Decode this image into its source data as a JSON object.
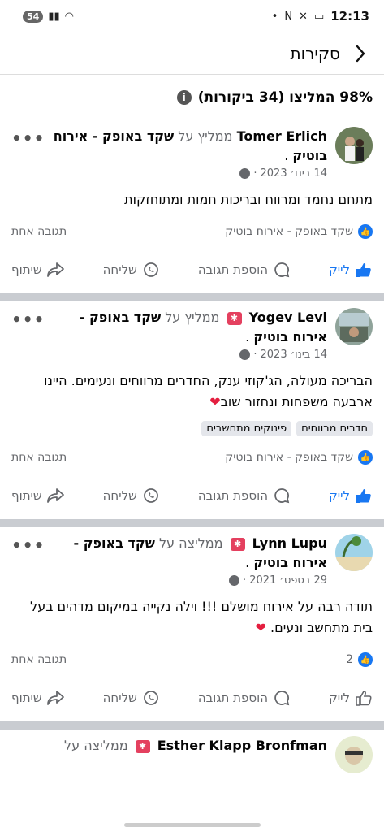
{
  "status_bar": {
    "notification_count": "54",
    "time": "12:13"
  },
  "header": {
    "title": "סקירות"
  },
  "summary": {
    "text": "98% המליצו (34 ביקורות)"
  },
  "colors": {
    "accent": "#1877f2",
    "badge": "#e4405f",
    "heart": "#e41e3f",
    "divider": "#c9ccd1"
  },
  "reviews": [
    {
      "name": "Tomer Erlich",
      "verb": "ממליץ על",
      "page": "שקד באופק - אירוח בוטיק",
      "date": "14 בינו׳ 2023",
      "body": "מתחם נחמד ומרווח ובריכות חמות ומתוחזקות",
      "tags": [],
      "reaction_label": "שקד באופק - אירוח בוטיק",
      "reply_count": "תגובה אחת",
      "liked": true,
      "has_badge": false
    },
    {
      "name": "Yogev Levi",
      "verb": "ממליץ על",
      "page": "שקד באופק - אירוח בוטיק",
      "date": "14 בינו׳ 2023",
      "body": "הבריכה מעולה, הג'קוזי ענק, החדרים מרווחים ונעימים. היינו ארבעה משפחות ונחזור שוב",
      "tags": [
        "חדרים מרווחים",
        "פינוקים מתחשבים"
      ],
      "reaction_label": "שקד באופק - אירוח בוטיק",
      "reply_count": "תגובה אחת",
      "liked": true,
      "has_badge": true
    },
    {
      "name": "Lynn Lupu",
      "verb": "ממליצה על",
      "page": "שקד באופק - אירוח בוטיק",
      "date": "29 בספט׳ 2021",
      "body": "תודה רבה על אירוח מושלם !!! וילה נקייה במיקום מדהים בעל בית מתחשב ונעים.",
      "tags": [],
      "reaction_label": "2",
      "reply_count": "תגובה אחת",
      "liked": false,
      "has_badge": true
    },
    {
      "name": "Esther Klapp Bronfman",
      "verb": "ממליצה על",
      "page": "",
      "date": "",
      "body": "",
      "tags": [],
      "reaction_label": "",
      "reply_count": "",
      "liked": false,
      "has_badge": true
    }
  ],
  "actions": {
    "like": "לייק",
    "comment": "הוספת תגובה",
    "send": "שליחה",
    "share": "שיתוף"
  }
}
